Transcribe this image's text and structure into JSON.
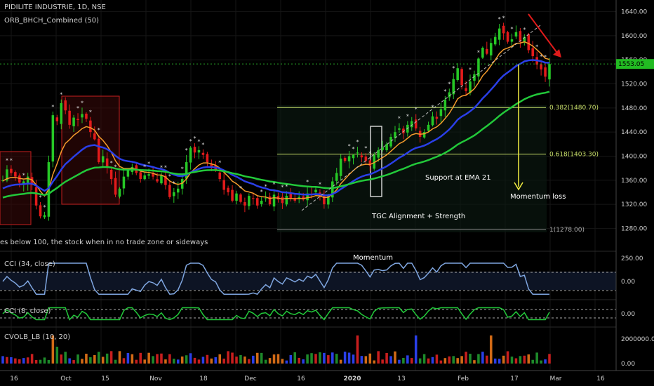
{
  "header": {
    "title": "PIDILITE INDUSTRIE, 1D, NSE",
    "indicator": "ORB_BHCH_Combined (50)",
    "description": "es below 100, the stock when in no trade zone or sideways"
  },
  "colors": {
    "background": "#000000",
    "grid": "#161616",
    "up_candle": "#26c826",
    "down_candle": "#e31b1b",
    "ema_short": "#f59b2c",
    "ema21": "#2a3fe8",
    "ema50": "#22c93a",
    "fib": "#c9e06a",
    "price_line": "#26a426",
    "cci34": "#7fa6e0",
    "cci8": "#22c93a",
    "annot_arrow": "#e01b1b",
    "yellow_arrow": "#f2ee42"
  },
  "chart_data": [
    {
      "type": "candlestick",
      "title": "PIDILITE INDUSTRIE, 1D, NSE",
      "ylim": [
        1250,
        1650
      ],
      "yticks": [
        1280,
        1320,
        1360,
        1400,
        1440,
        1480,
        1520,
        1560,
        1600,
        1640
      ],
      "ytick_labels": [
        "1280.00",
        "1320.00",
        "1360.00",
        "1400.00",
        "1440.00",
        "1480.00",
        "1520.00",
        "1560.00",
        "1600.00",
        "1640.00"
      ],
      "x_labels": [
        "16",
        "Oct",
        "15",
        "Nov",
        "18",
        "Dec",
        "16",
        "2020",
        "13",
        "Feb",
        "17",
        "Mar",
        "16"
      ],
      "last_price": "1553.05",
      "closes": [
        1360,
        1378,
        1372,
        1366,
        1356,
        1358,
        1366,
        1352,
        1318,
        1300,
        1302,
        1390,
        1468,
        1458,
        1488,
        1476,
        1452,
        1464,
        1460,
        1470,
        1462,
        1440,
        1428,
        1390,
        1400,
        1382,
        1362,
        1336,
        1346,
        1366,
        1378,
        1382,
        1372,
        1362,
        1368,
        1370,
        1366,
        1358,
        1368,
        1352,
        1332,
        1340,
        1346,
        1362,
        1390,
        1414,
        1406,
        1410,
        1402,
        1390,
        1380,
        1376,
        1362,
        1344,
        1340,
        1326,
        1338,
        1324,
        1318,
        1334,
        1330,
        1318,
        1326,
        1330,
        1320,
        1336,
        1328,
        1322,
        1334,
        1330,
        1326,
        1332,
        1328,
        1338,
        1336,
        1344,
        1332,
        1320,
        1334,
        1358,
        1372,
        1396,
        1392,
        1400,
        1402,
        1406,
        1398,
        1392,
        1384,
        1402,
        1410,
        1414,
        1420,
        1432,
        1440,
        1446,
        1438,
        1452,
        1458,
        1446,
        1432,
        1440,
        1452,
        1466,
        1462,
        1478,
        1494,
        1506,
        1528,
        1546,
        1518,
        1508,
        1524,
        1536,
        1562,
        1580,
        1570,
        1588,
        1598,
        1612,
        1604,
        1590,
        1594,
        1606,
        1590,
        1598,
        1576,
        1566,
        1552,
        1544,
        1532,
        1553
      ],
      "emas": [
        {
          "name": "EMA 9",
          "color": "#f59b2c",
          "period": 9
        },
        {
          "name": "EMA 21",
          "color": "#2a3fe8",
          "period": 21
        },
        {
          "name": "EMA 50",
          "color": "#22c93a",
          "period": 50
        }
      ],
      "fib_levels": [
        {
          "label": "0.382(1480.70)",
          "value": 1480.7
        },
        {
          "label": "0.618(1403.30)",
          "value": 1403.3
        },
        {
          "label": "1(1278.00)",
          "value": 1278.0
        }
      ]
    },
    {
      "type": "line",
      "title": "CCI (34, close)",
      "ylim": [
        -150,
        270
      ],
      "ytick_labels": [
        "250.00",
        "0.00"
      ],
      "bands": [
        100,
        -100
      ]
    },
    {
      "type": "line",
      "title": "CCI (8, close)",
      "ytick_labels": [
        "0.00"
      ]
    },
    {
      "type": "bar",
      "title": "CVOLB_LB (10, 20)",
      "ytick_labels": [
        "2000000.00",
        "0.00"
      ]
    }
  ],
  "annotations": {
    "support": "Support at EMA 21",
    "momentum_loss": "Momentum loss",
    "tgc": "TGC Alignment + Strength",
    "momentum": "Momentum"
  }
}
